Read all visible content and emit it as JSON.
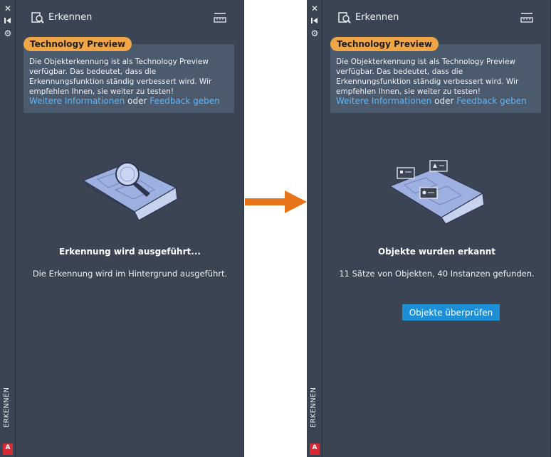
{
  "left_palette": {
    "controls": {
      "close": "✕",
      "pin": "⏸",
      "settings": "⚙"
    },
    "side_label": "ERKENNEN",
    "app_logo_letter": "A",
    "title": "Erkennen",
    "preview_badge": "Technology Preview",
    "info_text": "Die Objekterkennung ist als Technology Preview verfügbar. Das bedeutet, dass die Erkennungsfunktion ständig verbessert wird. Wir empfehlen Ihnen, sie weiter zu testen!",
    "link_more": "Weitere Informationen",
    "link_separator": " oder ",
    "link_feedback": "Feedback geben",
    "status_title": "Erkennung wird ausgeführt...",
    "status_text": "Die Erkennung wird im Hintergrund ausgeführt."
  },
  "right_palette": {
    "controls": {
      "close": "✕",
      "pin": "⏸",
      "settings": "⚙"
    },
    "side_label": "ERKENNEN",
    "app_logo_letter": "A",
    "title": "Erkennen",
    "preview_badge": "Technology Preview",
    "info_text": "Die Objekterkennung ist als Technology Preview verfügbar. Das bedeutet, dass die Erkennungsfunktion ständig verbessert wird. Wir empfehlen Ihnen, sie weiter zu testen!",
    "link_more": "Weitere Informationen",
    "link_separator": " oder ",
    "link_feedback": "Feedback geben",
    "status_title": "Objekte wurden erkannt",
    "status_text": "11 Sätze von Objekten, 40 Instanzen gefunden.",
    "review_button": "Objekte überprüfen"
  },
  "colors": {
    "panel_bg": "#3b4453",
    "info_bg": "#4b5a6c",
    "badge": "#f0a646",
    "link": "#5ab8ff",
    "button": "#1c8fd6",
    "arrow": "#e8741a"
  }
}
